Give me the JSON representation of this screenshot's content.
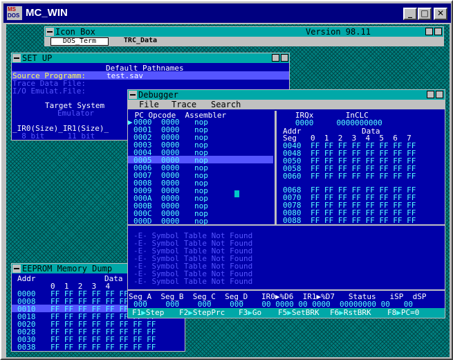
{
  "app": {
    "title": "MC_WIN",
    "logo_top": "MS",
    "logo_bottom": "DOS",
    "minimize": "_",
    "maximize": "□",
    "close": "✕"
  },
  "iconbox": {
    "title": "Icon Box",
    "version": "Version 98.11",
    "tabs": [
      "DOS_Term",
      "TRC_Data"
    ]
  },
  "setup": {
    "title": "SET UP",
    "heading": "Default Pathnames",
    "rows": [
      {
        "label": "Source Programm:",
        "value": "test.sav"
      },
      {
        "label": "Trace Data File:",
        "value": ""
      },
      {
        "label": "I/O Emulat.File:",
        "value": ""
      }
    ],
    "target_heading": "Target System",
    "target_value": "Emulator",
    "irq_header": "_IR0(Size)_IR1(Size)_",
    "irq_values": "  8 bit     11 bit"
  },
  "eeprom": {
    "title": "EEPROM Memory Dump",
    "col_addr": "Addr",
    "col_data": "Data",
    "cols": "0  1  2  3  4",
    "rows": [
      {
        "addr": "0000",
        "data": "FF FF FF FF FF FF FF FF"
      },
      {
        "addr": "0008",
        "data": "FF FF FF FF FF FF FF FF"
      },
      {
        "addr": "0010",
        "data": "FF FF FF FF FF FF FF FF"
      },
      {
        "addr": "0018",
        "data": "FF FF FF FF FF FF FF FF"
      },
      {
        "addr": "0020",
        "data": "FF FF FF FF FF FF FF FF"
      },
      {
        "addr": "0028",
        "data": "FF FF FF FF FF FF FF FF"
      },
      {
        "addr": "0030",
        "data": "FF FF FF FF FF FF FF FF"
      },
      {
        "addr": "0038",
        "data": "FF FF FF FF FF FF FF FF"
      }
    ]
  },
  "debugger": {
    "title": "Debugger",
    "menu": [
      "File",
      "Trace",
      "Search"
    ],
    "code_header": " PC Opcode  Assembler",
    "code": [
      {
        "pc": "0000",
        "op": "0000",
        "asm": "nop"
      },
      {
        "pc": "0001",
        "op": "0000",
        "asm": "nop"
      },
      {
        "pc": "0002",
        "op": "0000",
        "asm": "nop"
      },
      {
        "pc": "0003",
        "op": "0000",
        "asm": "nop"
      },
      {
        "pc": "0004",
        "op": "0000",
        "asm": "nop"
      },
      {
        "pc": "0005",
        "op": "0000",
        "asm": "nop"
      },
      {
        "pc": "0006",
        "op": "0000",
        "asm": "nop"
      },
      {
        "pc": "0007",
        "op": "0000",
        "asm": "nop"
      },
      {
        "pc": "0008",
        "op": "0000",
        "asm": "nop"
      },
      {
        "pc": "0009",
        "op": "0000",
        "asm": "nop"
      },
      {
        "pc": "000A",
        "op": "0000",
        "asm": "nop"
      },
      {
        "pc": "000B",
        "op": "0000",
        "asm": "nop"
      },
      {
        "pc": "000C",
        "op": "0000",
        "asm": "nop"
      },
      {
        "pc": "000D",
        "op": "0000",
        "asm": "nop"
      }
    ],
    "pc_marker": "▶",
    "irq_header": "   IRQx       InCLC",
    "irq_values": "   0000     0000000000",
    "mem_addr": "Addr",
    "mem_seg": "Seg",
    "mem_data": "Data",
    "mem_cols": "0  1  2  3  4  5  6  7",
    "mem1": [
      {
        "addr": "0040",
        "data": "FF FF FF FF FF FF FF FF"
      },
      {
        "addr": "0048",
        "data": "FF FF FF FF FF FF FF FF"
      },
      {
        "addr": "0050",
        "data": "FF FF FF FF FF FF FF FF"
      },
      {
        "addr": "0058",
        "data": "FF FF FF FF FF FF FF FF"
      },
      {
        "addr": "0060",
        "data": "FF FF FF FF FF FF FF FF"
      }
    ],
    "mem2": [
      {
        "addr": "0068",
        "data": "FF FF FF FF FF FF FF FF"
      },
      {
        "addr": "0070",
        "data": "FF FF FF FF FF FF FF FF"
      },
      {
        "addr": "0078",
        "data": "FF FF FF FF FF FF FF FF"
      },
      {
        "addr": "0080",
        "data": "FF FF FF FF FF FF FF FF"
      },
      {
        "addr": "0088",
        "data": "FF FF FF FF FF FF FF FF"
      }
    ],
    "messages": [
      "-E- Symbol Table Not Found",
      "-E- Symbol Table Not Found",
      "-E- Symbol Table Not Found",
      "-E- Symbol Table Not Found",
      "-E- Symbol Table Not Found",
      "-E- Symbol Table Not Found",
      "-E- Symbol Table Not Found"
    ],
    "reg_header": "Seg_A  Seg_B  Seg_C  Seg_D   IR0▶%D6  IR1▶%D7   Status   iSP  dSP",
    "reg_values": "000    000    000    000    00 0000 00 0000  00000000 00   00",
    "fkeys": [
      {
        "key": "F1",
        "label": "Step"
      },
      {
        "key": "F2",
        "label": "StepPrc"
      },
      {
        "key": "F3",
        "label": "Go"
      },
      {
        "key": "F5",
        "label": "SetBRK"
      },
      {
        "key": "F6",
        "label": "RstBRK"
      },
      {
        "key": "F8",
        "label": "PC=0"
      }
    ]
  }
}
